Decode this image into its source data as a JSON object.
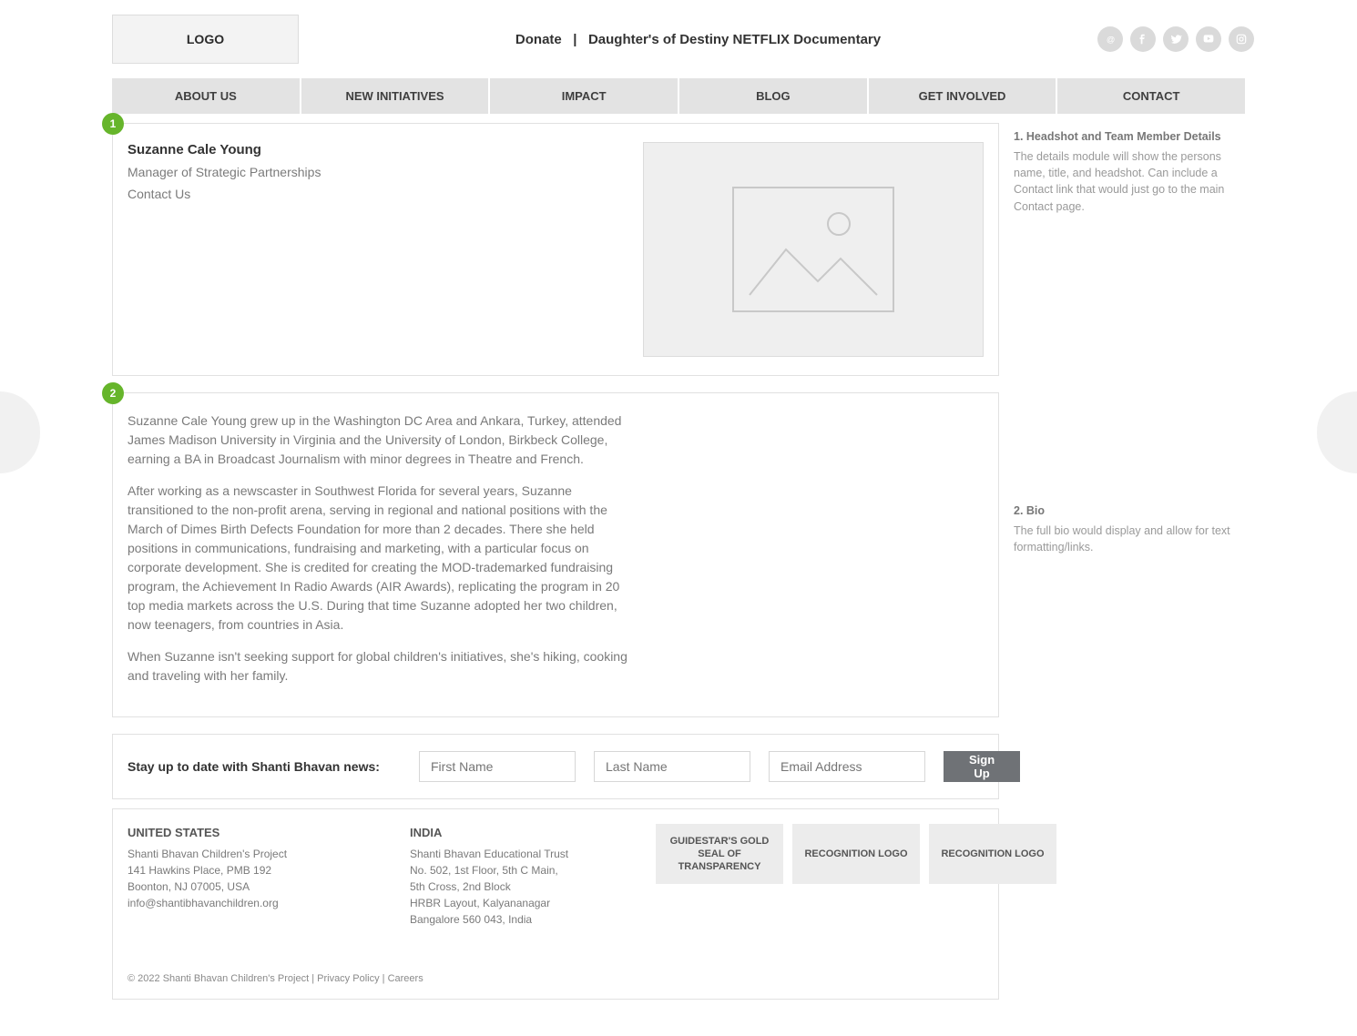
{
  "header": {
    "logo": "LOGO",
    "top_links": {
      "donate": "Donate",
      "sep": "|",
      "doc": "Daughter's of Destiny NETFLIX Documentary"
    }
  },
  "nav": [
    "ABOUT US",
    "NEW INITIATIVES",
    "IMPACT",
    "BLOG",
    "GET INVOLVED",
    "CONTACT"
  ],
  "person": {
    "name": "Suzanne Cale Young",
    "role": "Manager of Strategic Partnerships",
    "contact": "Contact Us"
  },
  "bio": {
    "p1": "Suzanne Cale Young grew up in the Washington DC Area and Ankara, Turkey, attended James Madison University in Virginia and the University of London, Birkbeck College, earning a BA in Broadcast Journalism with minor degrees in Theatre and French.",
    "p2": "After working as a newscaster in Southwest Florida for several years, Suzanne transitioned to the non-profit arena, serving in regional and national positions with the March of Dimes Birth Defects Foundation for more than 2 decades. There she held positions in communications, fundraising and marketing, with a particular focus on corporate development. She is credited for creating the MOD-trademarked fundraising program, the Achievement In Radio Awards (AIR Awards), replicating the program in 20 top media markets across the U.S. During that time Suzanne adopted her two children, now teenagers, from countries in Asia.",
    "p3": "When Suzanne isn't seeking support for global children's initiatives, she's hiking, cooking and traveling with her family."
  },
  "annotations": {
    "a1_title": "1. Headshot and Team Member Details",
    "a1_body": "The details module will show the persons name, title, and headshot. Can include a Contact link that would just go to the main Contact page.",
    "a2_title": "2. Bio",
    "a2_body": "The full bio would display and allow for text formatting/links."
  },
  "signup": {
    "label": "Stay up to date with Shanti Bhavan news:",
    "first_ph": "First Name",
    "last_ph": "Last Name",
    "email_ph": "Email Address",
    "button": "Sign Up"
  },
  "footer": {
    "us": {
      "country": "UNITED STATES",
      "l1": "Shanti Bhavan Children's Project",
      "l2": "141 Hawkins Place, PMB 192",
      "l3": "Boonton, NJ 07005, USA",
      "l4": "info@shantibhavanchildren.org"
    },
    "india": {
      "country": "INDIA",
      "l1": "Shanti Bhavan Educational Trust",
      "l2": "No. 502, 1st Floor, 5th C Main,",
      "l3": "5th Cross, 2nd Block",
      "l4": "HRBR Layout, Kalyananagar",
      "l5": "Bangalore 560 043, India"
    },
    "recog": [
      "GUIDESTAR'S GOLD SEAL OF TRANSPARENCY",
      "RECOGNITION LOGO",
      "RECOGNITION LOGO"
    ],
    "copyright": "© 2022 Shanti Bhavan Children's Project | ",
    "privacy": "Privacy Policy",
    "sep": " | ",
    "careers": "Careers"
  },
  "badges": {
    "one": "1",
    "two": "2"
  }
}
